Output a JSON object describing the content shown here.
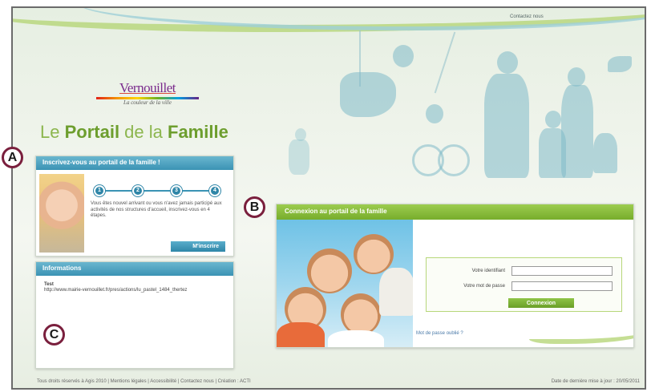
{
  "header": {
    "contact_link": "Contactez nous"
  },
  "logo": {
    "name": "Vernouillet",
    "tagline": "La couleur de la ville"
  },
  "portal_title": {
    "part1": "Le ",
    "part2": "Portail",
    "part3": " de la ",
    "part4": "Famille"
  },
  "markers": {
    "a": "A",
    "b": "B",
    "c": "C"
  },
  "signup_panel": {
    "title": "Inscrivez-vous au portail de la famille !",
    "steps": [
      "1",
      "2",
      "3",
      "4"
    ],
    "text": "Vous êtes nouvel arrivant ou vous n'avez jamais participé aux activités de nos structures d'accueil, inscrivez-vous en 4 étapes.",
    "button": "M'inscrire"
  },
  "info_panel": {
    "title": "Informations",
    "label": "Test",
    "text": "http://www.mairie-vernouillet.fr/pres/actions/lu_pastel_1484_thertez"
  },
  "login_panel": {
    "title": "Connexion au portail de la famille",
    "identifier_label": "Votre identifiant",
    "password_label": "Votre mot de passe",
    "identifier_value": "",
    "password_value": "",
    "connect_button": "Connexion",
    "forgot_link": "Mot de passe oublié ?"
  },
  "footer": {
    "left": "Tous droits réservés à Agis 2010 | Mentions légales | Accessibilité | Contactez nous | Création : ACTI",
    "right": "Date de dernière mise à jour : 20/05/2011"
  },
  "colors": {
    "green": "#77ad2c",
    "blue": "#3b93b4",
    "marker_ring": "#7a1f3d",
    "title_green": "#6d9e2e"
  }
}
